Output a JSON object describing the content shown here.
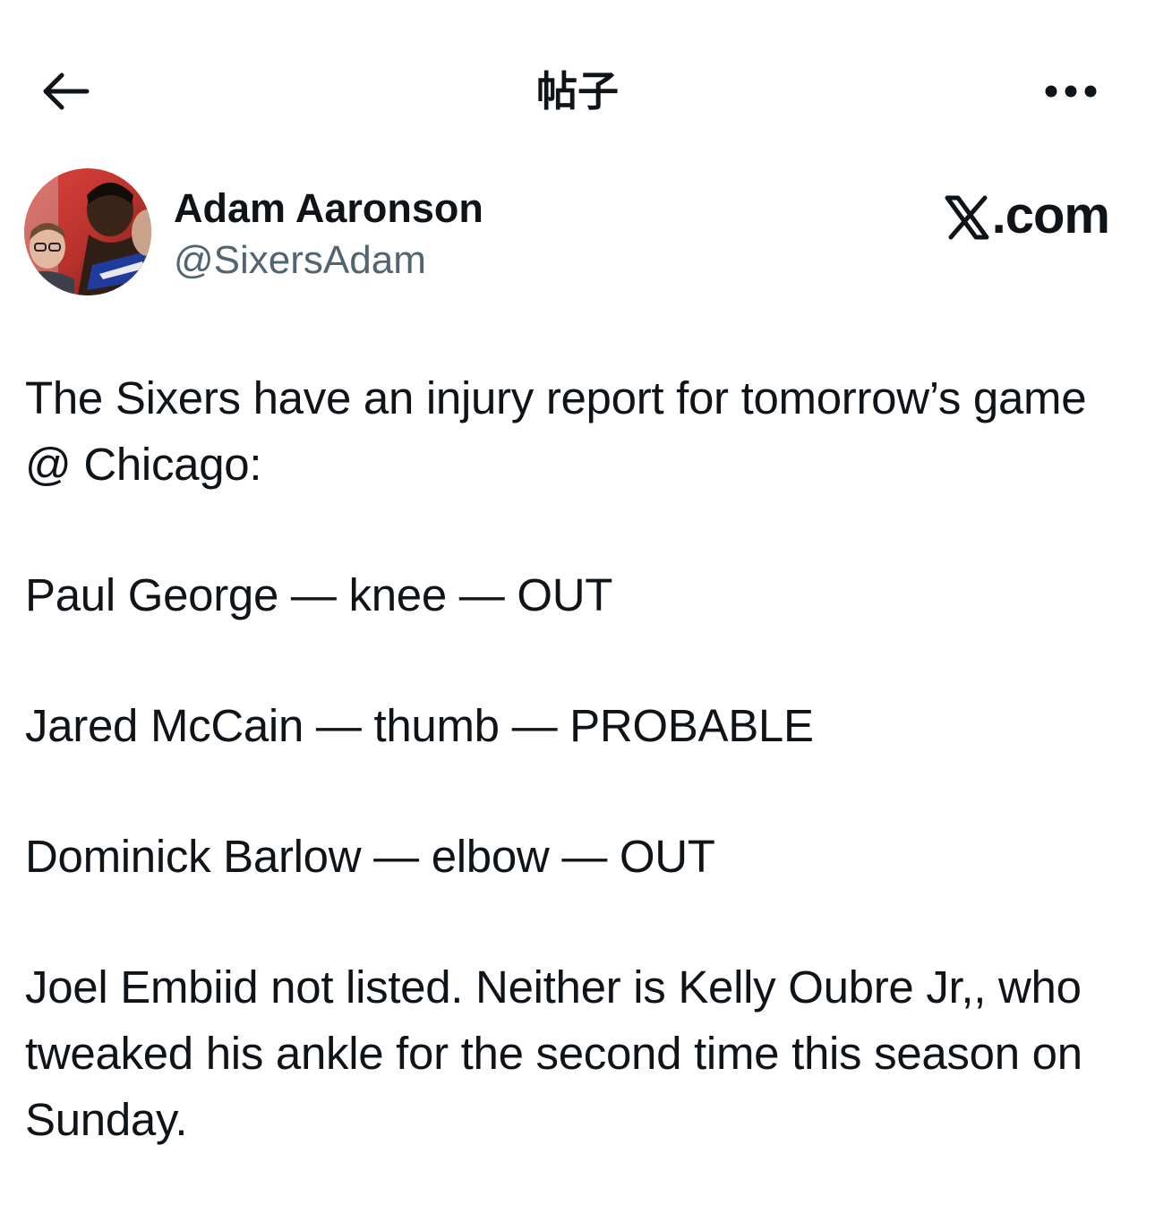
{
  "header": {
    "title": "帖子",
    "back_icon": "arrow-left-icon",
    "more_icon": "more-horizontal-icon"
  },
  "author": {
    "display_name": "Adam Aaronson",
    "handle": "@SixersAdam",
    "avatar": "avatar-photo"
  },
  "brand": {
    "logo_text": "X",
    "suffix": ".com"
  },
  "post": {
    "paragraphs": [
      "The Sixers have an injury report for tomorrow’s game @ Chicago:",
      "Paul George — knee — OUT",
      "Jared McCain — thumb — PROBABLE",
      "Dominick Barlow — elbow — OUT",
      "Joel Embiid not listed. Neither is Kelly Oubre Jr,, who tweaked his ankle for the second time this season on Sunday."
    ]
  },
  "colors": {
    "text": "#0f1419",
    "secondary": "#536471",
    "background": "#ffffff"
  }
}
